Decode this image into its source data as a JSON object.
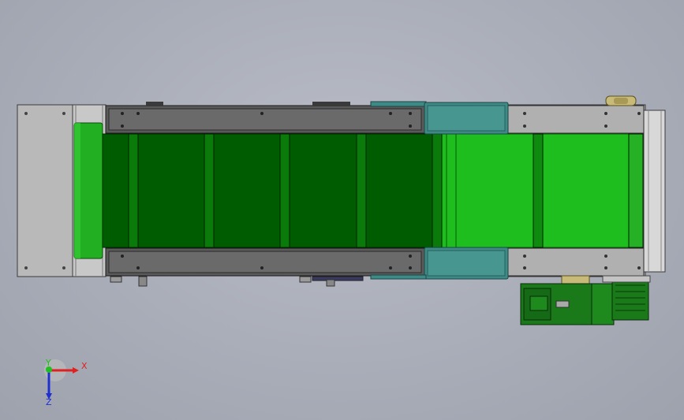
{
  "viewport": {
    "name": "conveyor-top-view"
  },
  "triad": {
    "x_label": "X",
    "y_label": "Y",
    "z_label": "Z",
    "x_color": "#e02020",
    "y_color": "#20c020",
    "z_color": "#2030d0"
  },
  "colors": {
    "background": "#a8acb7",
    "frame_gray": "#b8b8b8",
    "belt_dark": "#005c00",
    "belt_bright": "#1ebe1e",
    "roller_green": "#22b022",
    "guard_teal": "#3d8a86",
    "rail_dark": "#5a5a5a",
    "motor_green": "#1a7a1a"
  }
}
